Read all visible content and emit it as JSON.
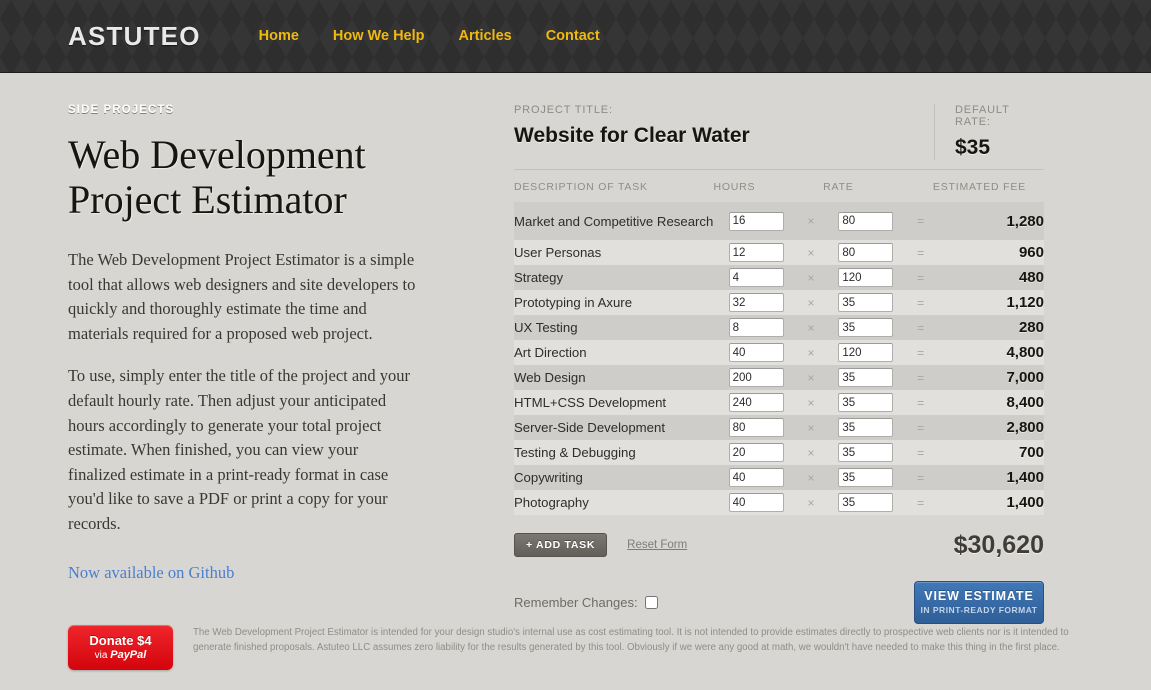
{
  "header": {
    "brand": "ASTUTEO",
    "nav": [
      {
        "label": "Home"
      },
      {
        "label": "How We Help"
      },
      {
        "label": "Articles"
      },
      {
        "label": "Contact"
      }
    ]
  },
  "intro": {
    "eyebrow": "SIDE PROJECTS",
    "title": "Web Development Project Estimator",
    "paragraph_1": "The Web Development Project Estimator is a simple tool that allows web designers and site developers to quickly and thoroughly estimate the time and materials required for a proposed web project.",
    "paragraph_2": "To use, simply enter the title of the project and your default hourly rate. Then adjust your anticipated hours accordingly to generate your total project estimate. When finished, you can view your finalized estimate in a print-ready format in case you'd like to save a PDF or print a copy for your records.",
    "github_link": "Now available on Github"
  },
  "estimator": {
    "project_title_label": "PROJECT TITLE:",
    "project_title_value": "Website for Clear Water",
    "default_rate_label": "DEFAULT RATE:",
    "default_rate_value": "$35",
    "columns": {
      "description": "DESCRIPTION OF TASK",
      "hours": "HOURS",
      "rate": "RATE",
      "fee": "ESTIMATED FEE"
    },
    "operators": {
      "multiply": "×",
      "equals": "="
    },
    "rows": [
      {
        "task": "Market and Competitive Research",
        "hours": "16",
        "rate": "80",
        "fee": "1,280"
      },
      {
        "task": "User Personas",
        "hours": "12",
        "rate": "80",
        "fee": "960"
      },
      {
        "task": "Strategy",
        "hours": "4",
        "rate": "120",
        "fee": "480"
      },
      {
        "task": "Prototyping in Axure",
        "hours": "32",
        "rate": "35",
        "fee": "1,120"
      },
      {
        "task": "UX Testing",
        "hours": "8",
        "rate": "35",
        "fee": "280"
      },
      {
        "task": "Art Direction",
        "hours": "40",
        "rate": "120",
        "fee": "4,800"
      },
      {
        "task": "Web Design",
        "hours": "200",
        "rate": "35",
        "fee": "7,000"
      },
      {
        "task": "HTML+CSS Development",
        "hours": "240",
        "rate": "35",
        "fee": "8,400"
      },
      {
        "task": "Server-Side Development",
        "hours": "80",
        "rate": "35",
        "fee": "2,800"
      },
      {
        "task": "Testing & Debugging",
        "hours": "20",
        "rate": "35",
        "fee": "700"
      },
      {
        "task": "Copywriting",
        "hours": "40",
        "rate": "35",
        "fee": "1,400"
      },
      {
        "task": "Photography",
        "hours": "40",
        "rate": "35",
        "fee": "1,400"
      }
    ],
    "add_task_label": "+ ADD TASK",
    "reset_form_label": "Reset Form",
    "grand_total": "$30,620",
    "remember_label": "Remember Changes:",
    "view_estimate_main": "VIEW ESTIMATE",
    "view_estimate_sub": "IN PRINT-READY FORMAT"
  },
  "footer": {
    "donate_main": "Donate $4",
    "donate_via": "via",
    "donate_brand": "PayPal",
    "disclaimer": "The Web Development Project Estimator is intended for your design studio's internal use as cost estimating tool. It is not intended to provide estimates directly to prospective web clients nor is it intended to generate finished proposals. Astuteo LLC assumes zero liability for the results generated by this tool. Obviously if we were any good at math, we wouldn't have needed to make this thing in the first place."
  },
  "colors": {
    "page_background": "#d8d6d2",
    "header_background": "#2e2e2e",
    "nav_accent": "#f0b90f",
    "link_accent": "#4a7fd0",
    "primary_button": "#3a6ea8",
    "donate_button": "#e01219"
  }
}
